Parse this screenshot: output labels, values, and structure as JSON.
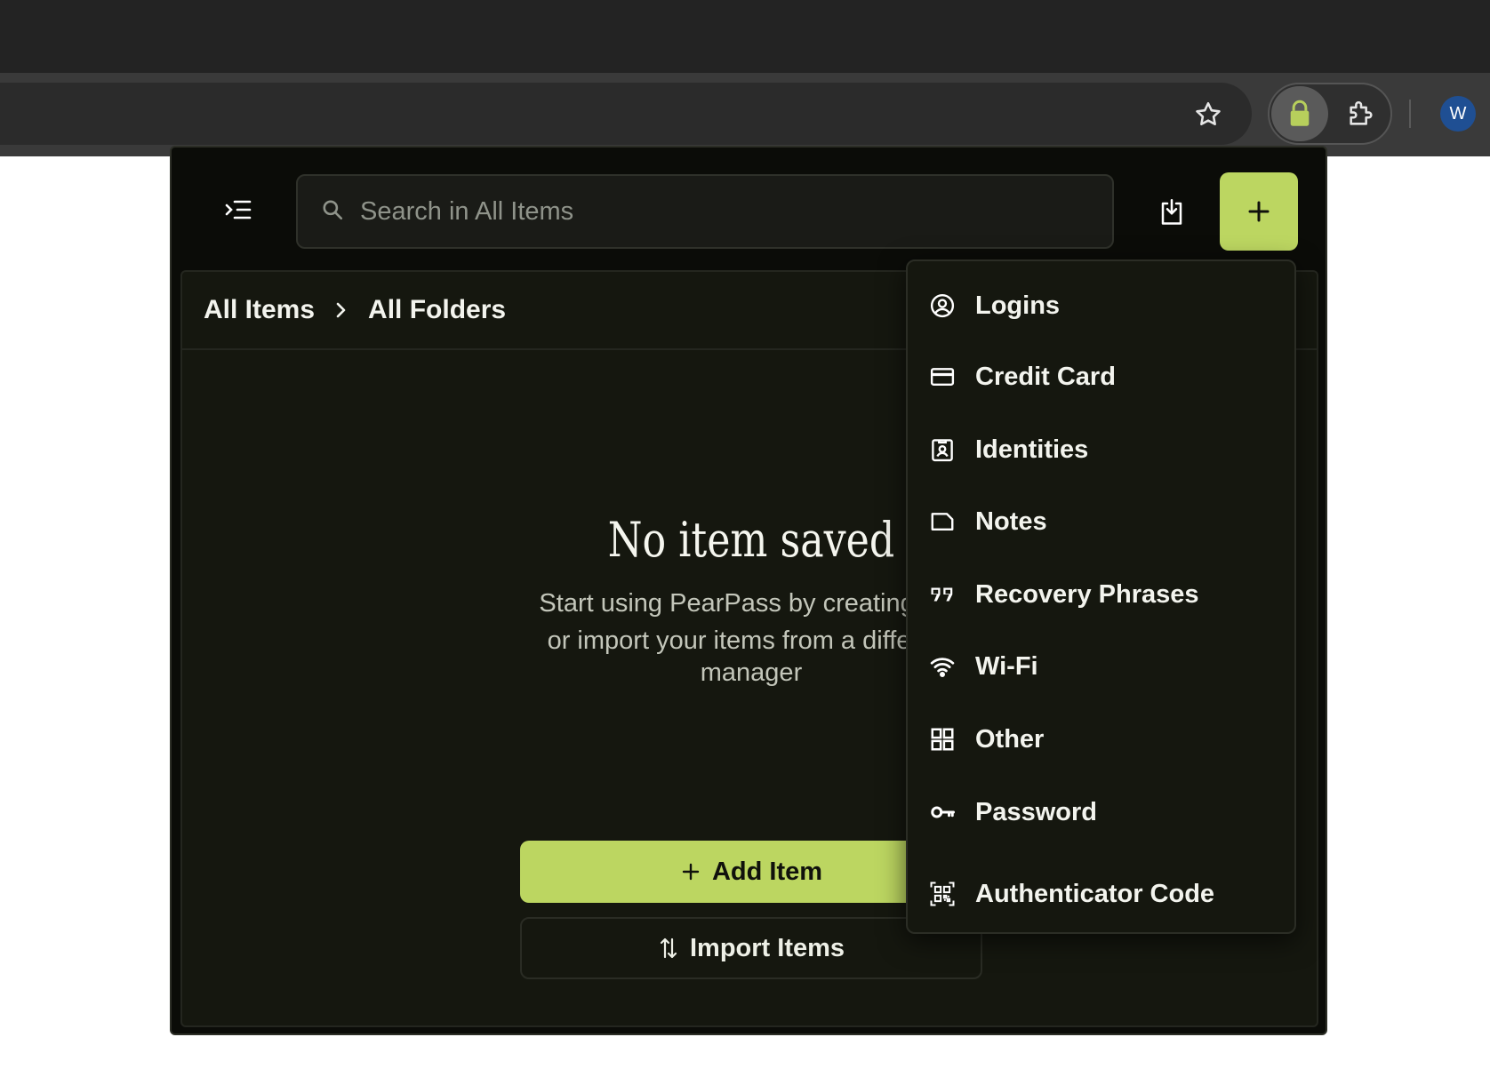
{
  "browser": {
    "avatar_initial": "W"
  },
  "search": {
    "placeholder": "Search in All Items"
  },
  "breadcrumb": {
    "items": [
      "All Items",
      "All Folders"
    ]
  },
  "empty_state": {
    "title": "No item saved",
    "description_lines": [
      "Start using PearPass by creating you",
      "or import your items from a different",
      "manager"
    ]
  },
  "buttons": {
    "add_item": "Add Item",
    "import_items": "Import Items"
  },
  "create_menu": {
    "items": [
      {
        "label": "Logins",
        "icon": "user-circle-icon"
      },
      {
        "label": "Credit Card",
        "icon": "credit-card-icon"
      },
      {
        "label": "Identities",
        "icon": "id-badge-icon"
      },
      {
        "label": "Notes",
        "icon": "note-icon"
      },
      {
        "label": "Recovery Phrases",
        "icon": "quote-icon"
      },
      {
        "label": "Wi-Fi",
        "icon": "wifi-icon"
      },
      {
        "label": "Other",
        "icon": "grid-icon"
      },
      {
        "label": "Password",
        "icon": "key-icon"
      },
      {
        "label": "Authenticator Code",
        "icon": "qr-code-icon"
      }
    ]
  },
  "colors": {
    "accent": "#bcd661",
    "background": "#0b0c08",
    "panel": "#15170f",
    "text": "#f3f4ee"
  }
}
